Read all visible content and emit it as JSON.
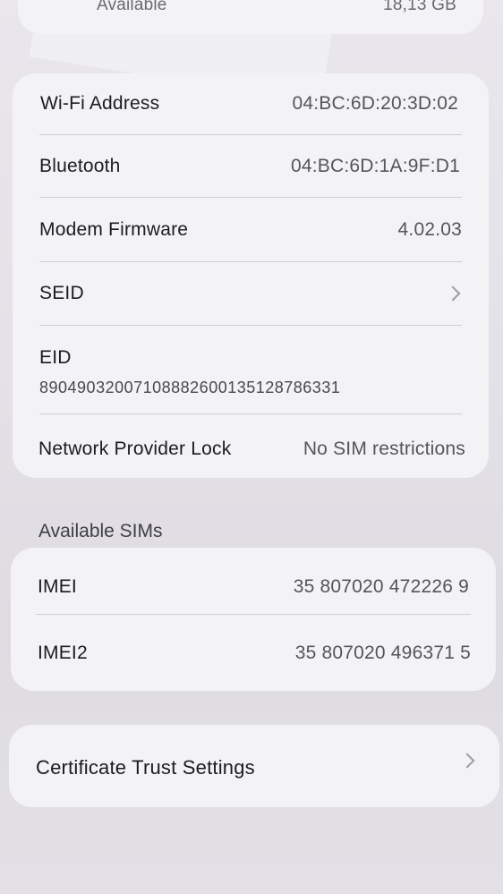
{
  "storage": {
    "label": "Available",
    "value": "18,13 GB"
  },
  "info": {
    "wifi_label": "Wi-Fi Address",
    "wifi_value": "04:BC:6D:20:3D:02",
    "bluetooth_label": "Bluetooth",
    "bluetooth_value": "04:BC:6D:1A:9F:D1",
    "modem_label": "Modem Firmware",
    "modem_value": "4.02.03",
    "seid_label": "SEID",
    "eid_label": "EID",
    "eid_value": "89049032007108882600135128786331",
    "lock_label": "Network Provider Lock",
    "lock_value": "No SIM restrictions"
  },
  "sims": {
    "header": "Available SIMs",
    "imei_label": "IMEI",
    "imei_value": "35 807020 472226 9",
    "imei2_label": "IMEI2",
    "imei2_value": "35 807020 496371 5"
  },
  "certificate": {
    "label": "Certificate Trust Settings"
  },
  "icons": {
    "seid_chevron": "chevron-right-icon",
    "cert_chevron": "chevron-right-icon"
  }
}
